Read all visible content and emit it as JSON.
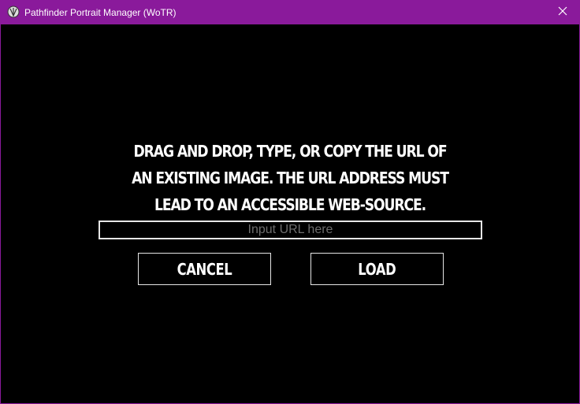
{
  "window": {
    "title": "Pathfinder Portrait Manager (WoTR)",
    "title_color": "#8a1a9b",
    "icons": {
      "app": "app-logo-icon",
      "close": "close-icon"
    }
  },
  "dialog": {
    "message": "DRAG AND DROP, TYPE, OR COPY THE URL OF AN EXISTING IMAGE. THE URL ADDRESS MUST LEAD TO AN ACCESSIBLE WEB-SOURCE.",
    "url_input": {
      "value": "",
      "placeholder": "Input URL here"
    },
    "cancel_label": "CANCEL",
    "load_label": "LOAD"
  }
}
